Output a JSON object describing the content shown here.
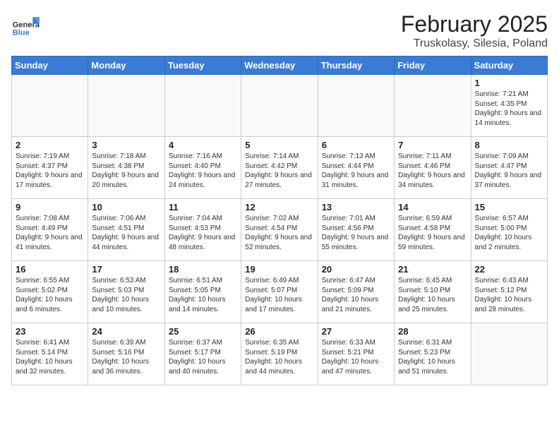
{
  "logo": {
    "general": "General",
    "blue": "Blue"
  },
  "title": {
    "month": "February 2025",
    "location": "Truskolasy, Silesia, Poland"
  },
  "weekdays": [
    "Sunday",
    "Monday",
    "Tuesday",
    "Wednesday",
    "Thursday",
    "Friday",
    "Saturday"
  ],
  "weeks": [
    [
      {
        "day": "",
        "info": ""
      },
      {
        "day": "",
        "info": ""
      },
      {
        "day": "",
        "info": ""
      },
      {
        "day": "",
        "info": ""
      },
      {
        "day": "",
        "info": ""
      },
      {
        "day": "",
        "info": ""
      },
      {
        "day": "1",
        "info": "Sunrise: 7:21 AM\nSunset: 4:35 PM\nDaylight: 9 hours and 14 minutes."
      }
    ],
    [
      {
        "day": "2",
        "info": "Sunrise: 7:19 AM\nSunset: 4:37 PM\nDaylight: 9 hours and 17 minutes."
      },
      {
        "day": "3",
        "info": "Sunrise: 7:18 AM\nSunset: 4:38 PM\nDaylight: 9 hours and 20 minutes."
      },
      {
        "day": "4",
        "info": "Sunrise: 7:16 AM\nSunset: 4:40 PM\nDaylight: 9 hours and 24 minutes."
      },
      {
        "day": "5",
        "info": "Sunrise: 7:14 AM\nSunset: 4:42 PM\nDaylight: 9 hours and 27 minutes."
      },
      {
        "day": "6",
        "info": "Sunrise: 7:13 AM\nSunset: 4:44 PM\nDaylight: 9 hours and 31 minutes."
      },
      {
        "day": "7",
        "info": "Sunrise: 7:11 AM\nSunset: 4:46 PM\nDaylight: 9 hours and 34 minutes."
      },
      {
        "day": "8",
        "info": "Sunrise: 7:09 AM\nSunset: 4:47 PM\nDaylight: 9 hours and 37 minutes."
      }
    ],
    [
      {
        "day": "9",
        "info": "Sunrise: 7:08 AM\nSunset: 4:49 PM\nDaylight: 9 hours and 41 minutes."
      },
      {
        "day": "10",
        "info": "Sunrise: 7:06 AM\nSunset: 4:51 PM\nDaylight: 9 hours and 44 minutes."
      },
      {
        "day": "11",
        "info": "Sunrise: 7:04 AM\nSunset: 4:53 PM\nDaylight: 9 hours and 48 minutes."
      },
      {
        "day": "12",
        "info": "Sunrise: 7:02 AM\nSunset: 4:54 PM\nDaylight: 9 hours and 52 minutes."
      },
      {
        "day": "13",
        "info": "Sunrise: 7:01 AM\nSunset: 4:56 PM\nDaylight: 9 hours and 55 minutes."
      },
      {
        "day": "14",
        "info": "Sunrise: 6:59 AM\nSunset: 4:58 PM\nDaylight: 9 hours and 59 minutes."
      },
      {
        "day": "15",
        "info": "Sunrise: 6:57 AM\nSunset: 5:00 PM\nDaylight: 10 hours and 2 minutes."
      }
    ],
    [
      {
        "day": "16",
        "info": "Sunrise: 6:55 AM\nSunset: 5:02 PM\nDaylight: 10 hours and 6 minutes."
      },
      {
        "day": "17",
        "info": "Sunrise: 6:53 AM\nSunset: 5:03 PM\nDaylight: 10 hours and 10 minutes."
      },
      {
        "day": "18",
        "info": "Sunrise: 6:51 AM\nSunset: 5:05 PM\nDaylight: 10 hours and 14 minutes."
      },
      {
        "day": "19",
        "info": "Sunrise: 6:49 AM\nSunset: 5:07 PM\nDaylight: 10 hours and 17 minutes."
      },
      {
        "day": "20",
        "info": "Sunrise: 6:47 AM\nSunset: 5:09 PM\nDaylight: 10 hours and 21 minutes."
      },
      {
        "day": "21",
        "info": "Sunrise: 6:45 AM\nSunset: 5:10 PM\nDaylight: 10 hours and 25 minutes."
      },
      {
        "day": "22",
        "info": "Sunrise: 6:43 AM\nSunset: 5:12 PM\nDaylight: 10 hours and 28 minutes."
      }
    ],
    [
      {
        "day": "23",
        "info": "Sunrise: 6:41 AM\nSunset: 5:14 PM\nDaylight: 10 hours and 32 minutes."
      },
      {
        "day": "24",
        "info": "Sunrise: 6:39 AM\nSunset: 5:16 PM\nDaylight: 10 hours and 36 minutes."
      },
      {
        "day": "25",
        "info": "Sunrise: 6:37 AM\nSunset: 5:17 PM\nDaylight: 10 hours and 40 minutes."
      },
      {
        "day": "26",
        "info": "Sunrise: 6:35 AM\nSunset: 5:19 PM\nDaylight: 10 hours and 44 minutes."
      },
      {
        "day": "27",
        "info": "Sunrise: 6:33 AM\nSunset: 5:21 PM\nDaylight: 10 hours and 47 minutes."
      },
      {
        "day": "28",
        "info": "Sunrise: 6:31 AM\nSunset: 5:23 PM\nDaylight: 10 hours and 51 minutes."
      },
      {
        "day": "",
        "info": ""
      }
    ]
  ]
}
